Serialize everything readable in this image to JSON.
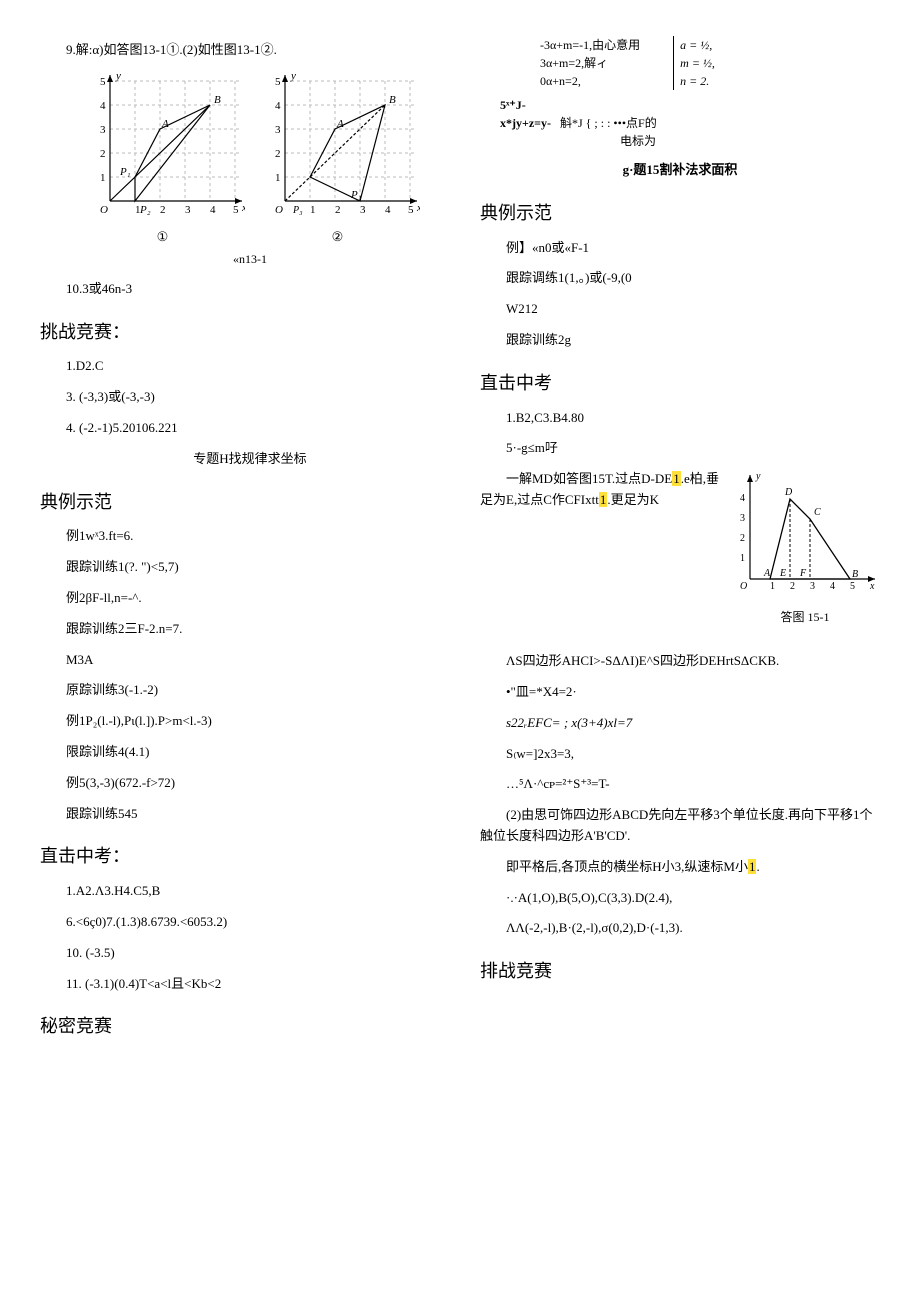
{
  "left": {
    "line1": "9.解:α)如答图13-1①.(2)如性图13-1②.",
    "diagram_axes": {
      "yticks": [
        1,
        2,
        3,
        4,
        5
      ],
      "xticks": [
        1,
        2,
        3,
        4,
        5
      ],
      "labels": [
        "A",
        "B",
        "P₁",
        "P₂",
        "O",
        "x",
        "y"
      ]
    },
    "cap1": "①",
    "cap2": "②",
    "cap_main": "«n13-1",
    "line2": "10.3或46n-3",
    "h_challenge": "挑战竞赛：",
    "c1": "1.D2.C",
    "c2": "3.  (-3,3)或(-3,-3)",
    "c3": "4.  (-2.-1)5.20106.221",
    "topic_h": "专题H找规律求坐标",
    "h_example": "典例示范",
    "e1": "例1wˣ3.ft=6.",
    "e2": "跟踪训练1(?. \")<5,7)",
    "e3": "例2βF-ll,n=-^.",
    "e4": "跟踪训练2三F-2.n=7.",
    "e5": "M3A",
    "e6": "原踪训练3(-1.-2)",
    "e7": "例1P₂(l.-l),Pι(l.]).P>m<l.-3)",
    "e8": "限踪训练4(4.1)",
    "e9": "例5(3,-3)(672.-f>72)",
    "e10": "跟踪训练545",
    "h_exam": "直击中考：",
    "x1": "1.A2.Λ3.H4.C5,B",
    "x2": "6.<6ç0)7.(1.3)8.6739.<6053.2)",
    "x3": "10. (-3.5)",
    "x4": "11. (-3.1)(0.4)T<a<l且<Kb<2",
    "h_secret": "秘密竞赛"
  },
  "right": {
    "eq1a": "-3α+m=-1,",
    "eq1b": "3α+m=2,解ィ",
    "eq1c": "0α+n=2,",
    "eq1mid": "由心意用",
    "eq_res1": "a = ½,",
    "eq_res2": "m = ½,",
    "eq_res3": "n = 2.",
    "eq2a": "5ˣ⁺J-",
    "eq2b": "x*jy+z=y-",
    "eq2mid": "斛*J  { ;   :  :   •••点F的",
    "eq2c": "电标为",
    "topic_g": "g·题15割补法求面积",
    "h_example": "典例示范",
    "d1": "例】«n0或«F-1",
    "d2": "跟踪调练1(1,。)或(-9,(0",
    "d3": "W212",
    "d4": "跟踪训练2g",
    "h_exam": "直击中考",
    "z1": "1.B2,C3.B4.80",
    "z2": "5·-g≤m吇",
    "z3a": "一解MD如答图15T.过点D-DE",
    "z3hl1": "1",
    "z3b": ".e柏,垂足为E,过点C作CFIxtt",
    "z3hl2": "1",
    "z3c": ".更足为K",
    "fig_caption": "答图 15-1",
    "fig_axes": {
      "yticks": [
        1,
        2,
        3,
        4
      ],
      "xticks": [
        1,
        2,
        3,
        4,
        5
      ],
      "labels": [
        "A",
        "B",
        "C",
        "D",
        "E",
        "F",
        "O",
        "x",
        "y"
      ]
    },
    "z4": "ΛS四边形AHCI>-SΔΛI)E^S四边形DEHrtSΔCKB.",
    "z5": "•\"皿=*X4=2·",
    "z6": "s22ᵣEFC= ;   x(3+4)xl=7",
    "z7": "S₍w=]2x3=3,",
    "z8": "…⁵Λ·^cᴘ=²⁺S⁺³=T-",
    "z9": "(2)由思可饰四边形ABCD先向左平移3个单位长度.再向下平移1个触位长度科四边形A'B'CD'.",
    "z10a": "即平格后,各顶点的横坐标H小3,纵速标M小",
    "z10hl": "1",
    "z10b": ".",
    "z11": "·.·A(1,O),B(5,O),C(3,3).D(2.4),",
    "z12": "ΛΛ(-2,-l),B·(2,-l),σ(0,2),D·(-1,3).",
    "h_pai": "排战竞赛"
  }
}
